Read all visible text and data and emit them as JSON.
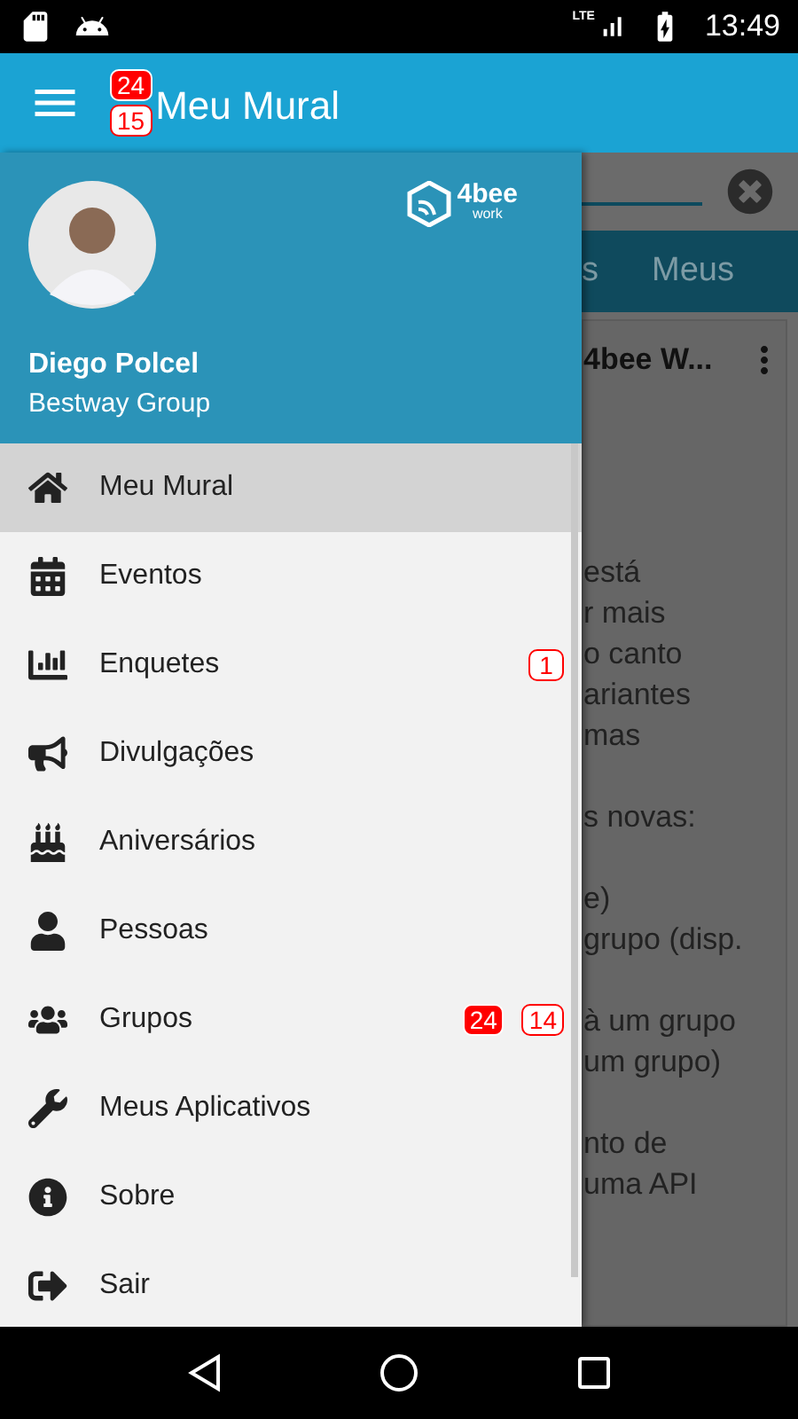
{
  "status_bar": {
    "network": "LTE",
    "time": "13:49"
  },
  "app_bar": {
    "title": "Meu Mural",
    "badges": [
      {
        "text": "24",
        "kind": "filled"
      },
      {
        "text": "15",
        "kind": "outlined"
      }
    ]
  },
  "drawer": {
    "user": {
      "name": "Diego Polcel",
      "company": "Bestway Group"
    },
    "logo": {
      "brand": "4bee",
      "sub": "work"
    },
    "items": [
      {
        "label": "Meu Mural",
        "selected": true
      },
      {
        "label": "Eventos",
        "selected": false
      },
      {
        "label": "Enquetes",
        "selected": false,
        "badges": [
          {
            "text": "1",
            "kind": "outlined"
          }
        ]
      },
      {
        "label": "Divulgações",
        "selected": false
      },
      {
        "label": "Aniversários",
        "selected": false
      },
      {
        "label": "Pessoas",
        "selected": false
      },
      {
        "label": "Grupos",
        "selected": false,
        "badges": [
          {
            "text": "24",
            "kind": "filled"
          },
          {
            "text": "14",
            "kind": "outlined"
          }
        ]
      },
      {
        "label": "Meus Aplicativos",
        "selected": false
      },
      {
        "label": "Sobre",
        "selected": false
      },
      {
        "label": "Sair",
        "selected": false
      }
    ]
  },
  "background": {
    "tabs": [
      {
        "label": "s",
        "selected": false
      },
      {
        "label": "Meus",
        "selected": false
      }
    ],
    "card_title": "4bee W...",
    "paragraphs": [
      [
        "está",
        "r mais",
        "o canto",
        "ariantes",
        "mas"
      ],
      [
        "s novas:"
      ],
      [
        "e)",
        "grupo (disp."
      ],
      [
        "à um grupo",
        "um grupo)"
      ],
      [
        "nto de",
        "uma API"
      ]
    ]
  }
}
